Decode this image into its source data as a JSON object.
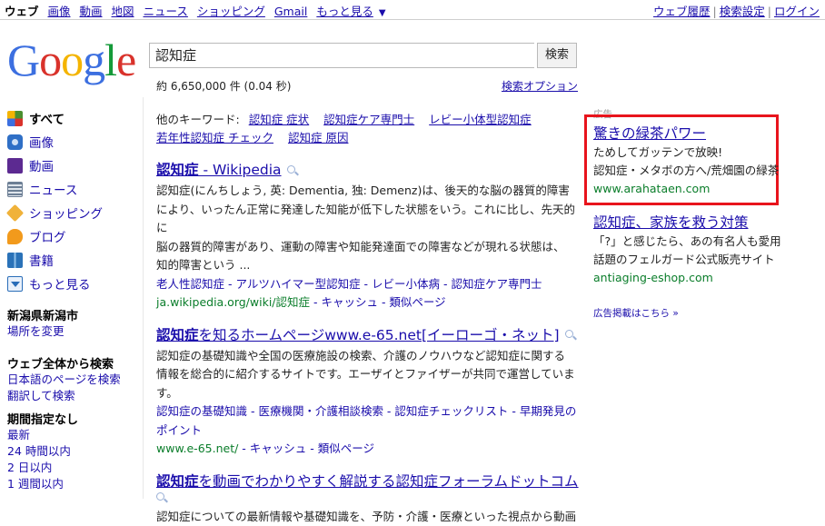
{
  "topnav": {
    "items": [
      "ウェブ",
      "画像",
      "動画",
      "地図",
      "ニュース",
      "ショッピング",
      "Gmail",
      "もっと見る"
    ],
    "more_arrow": "▼",
    "right": [
      "ウェブ履歴",
      "検索設定",
      "ログイン"
    ],
    "separator": "|"
  },
  "logo": {
    "text": "Google",
    "colors": [
      "#3c6fe0",
      "#d9322b",
      "#f4b400",
      "#3c6fe0",
      "#159a39",
      "#d9322b"
    ]
  },
  "search": {
    "query": "認知症",
    "button": "検索",
    "stats": "約 6,650,000 件 (0.04 秒)",
    "options": "検索オプション"
  },
  "sidebar": {
    "types": [
      {
        "label": "すべて",
        "icon": "all-icon",
        "color": "#4a8f2f"
      },
      {
        "label": "画像",
        "icon": "camera-icon",
        "color": "#2f6fc6"
      },
      {
        "label": "動画",
        "icon": "video-icon",
        "color": "#5c2a91"
      },
      {
        "label": "ニュース",
        "icon": "news-icon",
        "color": "#6d7f95"
      },
      {
        "label": "ショッピング",
        "icon": "tag-icon",
        "color": "#f0b23a"
      },
      {
        "label": "ブログ",
        "icon": "blog-icon",
        "color": "#f29a1c"
      },
      {
        "label": "書籍",
        "icon": "book-icon",
        "color": "#2a72b8"
      },
      {
        "label": "もっと見る",
        "icon": "more-down-icon",
        "color": "#2a6db8"
      }
    ],
    "location": {
      "heading": "新潟県新潟市",
      "link": "場所を変更"
    },
    "scope": {
      "heading": "ウェブ全体から検索",
      "links": [
        "日本語のページを検索",
        "翻訳して検索"
      ]
    },
    "time": {
      "heading": "期間指定なし",
      "links": [
        "最新",
        "24 時間以内",
        "2 日以内",
        "1 週間以内"
      ]
    }
  },
  "related": {
    "label": "他のキーワード:",
    "links": [
      "認知症 症状",
      "認知症ケア専門士",
      "レビー小体型認知症",
      "若年性認知症 チェック",
      "認知症 原因"
    ]
  },
  "results": [
    {
      "title_bold": "認知症",
      "title_rest": " - Wikipedia",
      "snippet": [
        "認知症(にんちしょう, 英: Dementia, 独: Demenz)は、後天的な脳の器質的障害",
        "により、いったん正常に発達した知能が低下した状態をいう。これに比し、先天的に",
        "脳の器質的障害があり、運動の障害や知能発達面での障害などが現れる状態は、",
        "知的障害という ..."
      ],
      "sublinks": "老人性認知症 - アルツハイマー型認知症 - レビー小体病 - 認知症ケア専門士",
      "url": "ja.wikipedia.org/wiki/認知症",
      "cache": " - キャッシュ - 類似ページ"
    },
    {
      "title_bold": "認知症",
      "title_rest": "を知るホームページwww.e-65.net[イーローゴ・ネット]",
      "snippet": [
        "認知症の基礎知識や全国の医療施設の検索、介護のノウハウなど認知症に関する",
        "情報を総合的に紹介するサイトです。エーザイとファイザーが共同で運営しています。"
      ],
      "sublinks": "認知症の基礎知識 - 医療機関・介護相談検索 - 認知症チェックリスト - 早期発見の",
      "sublinks2": "ポイント",
      "url": "www.e-65.net/",
      "cache": " - キャッシュ - 類似ページ"
    },
    {
      "title_bold": "認知症",
      "title_rest": "を動画でわかりやすく解説する認知症フォーラムドットコム",
      "snippet": [
        "認知症についての最新情報や基礎知識を、予防・介護・医療といった視点から動画"
      ]
    }
  ],
  "ads": {
    "label": "広告",
    "items": [
      {
        "title": "驚きの緑茶パワー",
        "lines": [
          "ためしてガッテンで放映!",
          "認知症・メタボの方へ/荒畑園の緑茶"
        ],
        "url": "www.arahataen.com"
      },
      {
        "title": "認知症、家族を救う対策",
        "lines": [
          "「?」と感じたら、あの有名人も愛用",
          "話題のフェルガード公式販売サイト"
        ],
        "url": "antiaging-eshop.com"
      }
    ],
    "more": "広告掲載はこちら »",
    "highlight_color": "#e8141c"
  }
}
